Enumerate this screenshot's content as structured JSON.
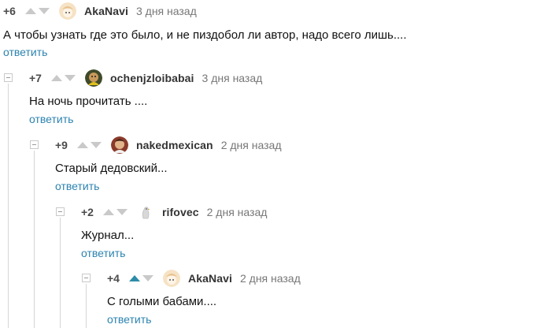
{
  "comments": [
    {
      "rating": "+6",
      "username": "AkaNavi",
      "time": "3 дня назад",
      "text": "А чтобы узнать где это было, и не пиздобол ли автор, надо всего лишь....",
      "reply_label": "ответить",
      "avatar": "cute-character-avatar"
    },
    {
      "rating": "+7",
      "username": "ochenjzloibabai",
      "time": "3 дня назад",
      "text": "На ночь прочитать ....",
      "reply_label": "ответить",
      "avatar": "person-photo-avatar"
    },
    {
      "rating": "+9",
      "username": "nakedmexican",
      "time": "2 дня назад",
      "text": "Старый дедовский...",
      "reply_label": "ответить",
      "avatar": "person-photo-avatar"
    },
    {
      "rating": "+2",
      "username": "rifovec",
      "time": "2 дня назад",
      "text": "Журнал...",
      "reply_label": "ответить",
      "avatar": "bird-avatar"
    },
    {
      "rating": "+4",
      "username": "AkaNavi",
      "time": "2 дня назад",
      "text": "С голыми бабами....",
      "reply_label": "ответить",
      "avatar": "cute-character-avatar",
      "upvoted": true
    }
  ],
  "colors": {
    "link": "#2c83b0",
    "upvote_active": "#2d8ca8",
    "arrow_inactive": "#c9c9c9"
  }
}
